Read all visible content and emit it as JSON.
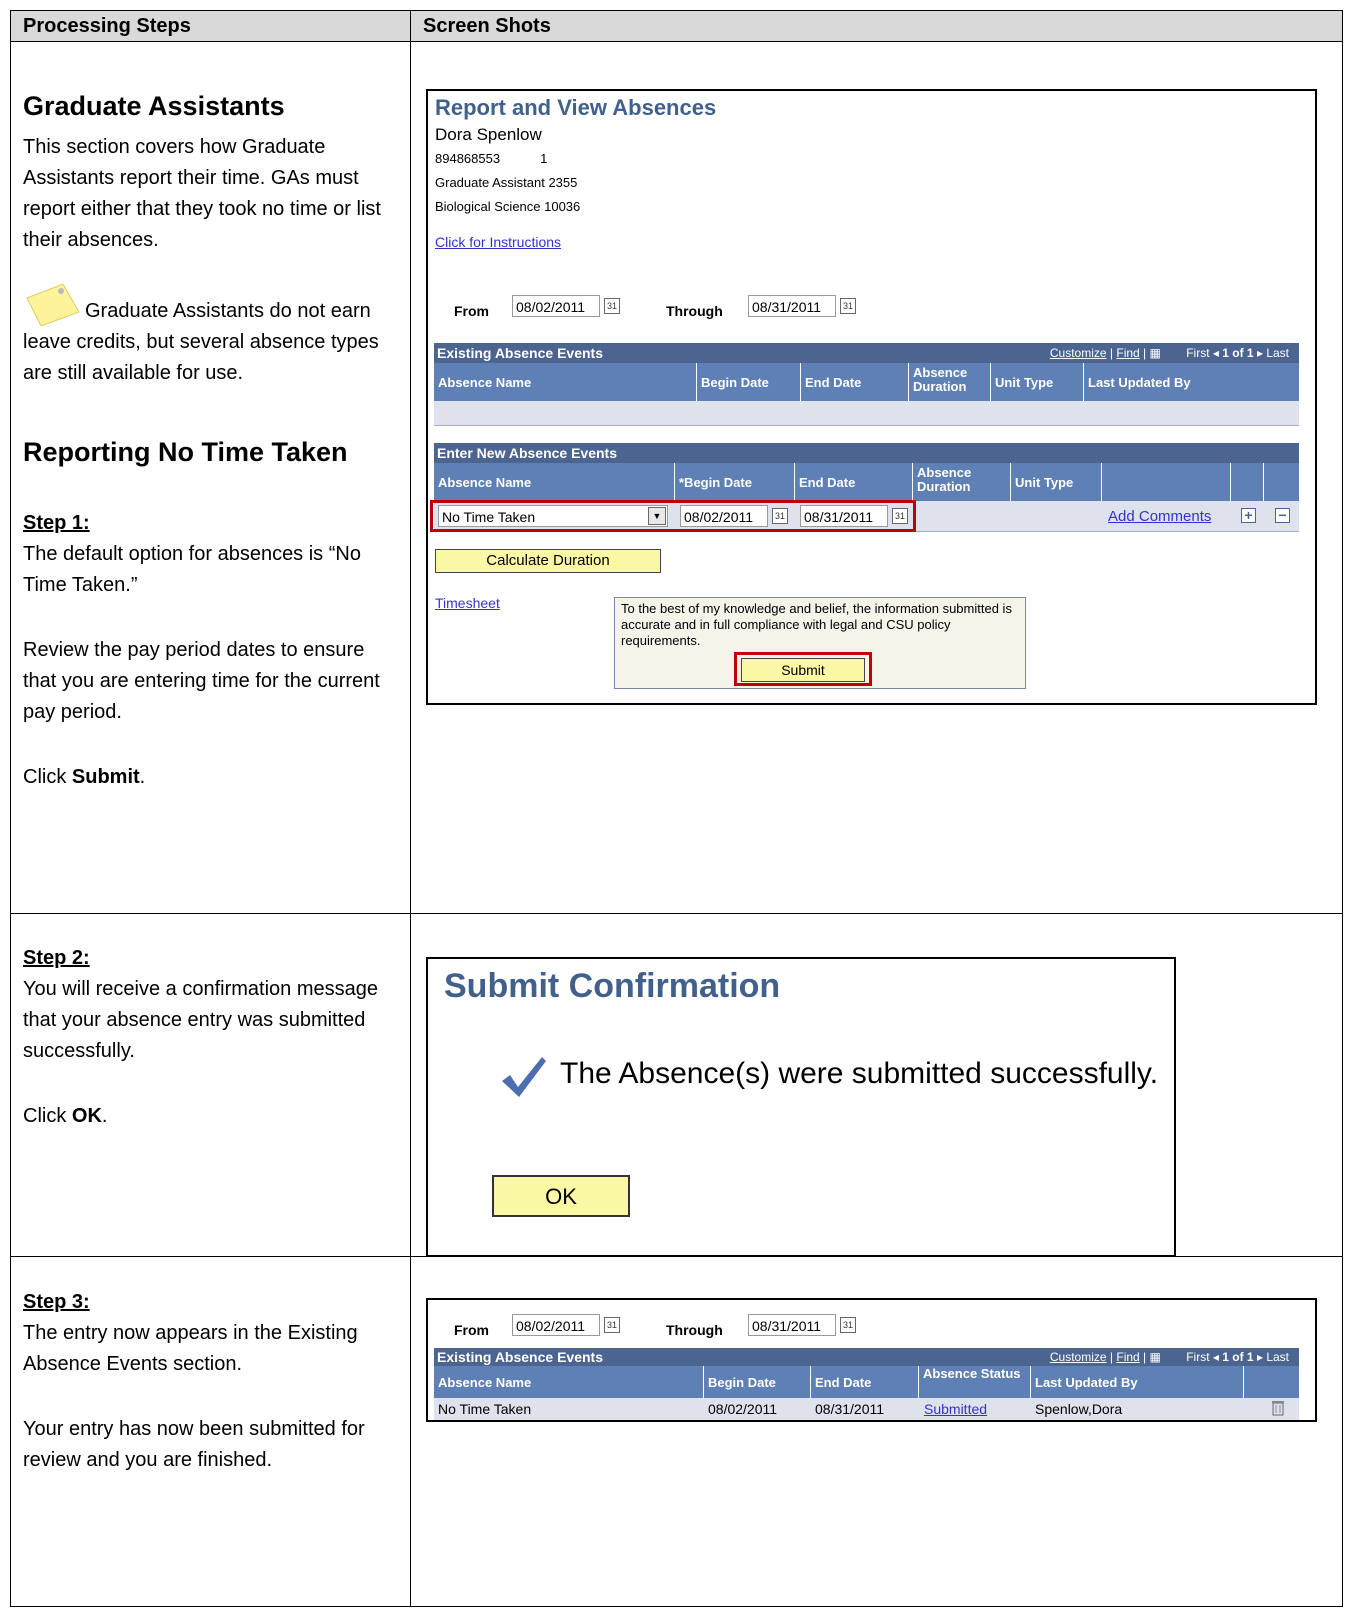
{
  "header": {
    "col1": "Processing Steps",
    "col2": "Screen Shots"
  },
  "section1": {
    "title": "Graduate Assistants",
    "intro": "This section covers how Graduate Assistants report their time. GAs must report either that they took no time or list their absences.",
    "note": "Graduate Assistants do not earn leave credits, but several absence types are still available for use.",
    "subtitle": "Reporting No Time Taken",
    "step1_label": "Step 1:",
    "step1_text": "The default option for absences is “No Time Taken.”",
    "review_text": "Review the pay period dates to ensure that you are entering time for the current pay period.",
    "click_prefix": "Click ",
    "click_bold": "Submit",
    "click_suffix": "."
  },
  "section2": {
    "step_label": "Step 2:",
    "text": "You will receive a confirmation message that your absence entry was submitted successfully.",
    "click_prefix": "Click ",
    "click_bold": "OK",
    "click_suffix": "."
  },
  "section3": {
    "step_label": "Step 3:",
    "text": "The entry now appears in the Existing Absence Events section.",
    "text2": "Your entry has now been submitted for review and you are finished."
  },
  "shot1": {
    "title": "Report and View Absences",
    "name": "Dora Spenlow",
    "emplid": "894868553",
    "record": "1",
    "job": "Graduate Assistant  2355",
    "dept": "Biological Science  10036",
    "instructions_link": "Click for Instructions",
    "from_label": "From",
    "from_value": "08/02/2011",
    "through_label": "Through",
    "through_value": "08/31/2011",
    "existing_header": "Existing Absence Events",
    "customize": "Customize",
    "find": "Find",
    "sep": "|",
    "first": "First",
    "pager": "1 of 1",
    "last": "Last",
    "existing_cols": [
      "Absence Name",
      "Begin Date",
      "End Date",
      "Absence Duration",
      "Unit Type",
      "Last Updated By"
    ],
    "new_header": "Enter New Absence Events",
    "new_cols": [
      "Absence Name",
      "*Begin Date",
      "End Date",
      "Absence Duration",
      "Unit Type"
    ],
    "select_value": "No Time Taken",
    "new_begin": "08/02/2011",
    "new_end": "08/31/2011",
    "add_comments": "Add Comments",
    "calc_button": "Calculate Duration",
    "timesheet_link": "Timesheet",
    "attest": "To the best of my knowledge and belief, the information submitted is accurate and in full compliance with legal and CSU policy requirements.",
    "submit_button": "Submit"
  },
  "shot2": {
    "title": "Submit Confirmation",
    "message": "The Absence(s) were submitted successfully.",
    "ok_button": "OK"
  },
  "shot3": {
    "from_label": "From",
    "from_value": "08/02/2011",
    "through_label": "Through",
    "through_value": "08/31/2011",
    "existing_header": "Existing Absence Events",
    "customize": "Customize",
    "find": "Find",
    "sep": "|",
    "first": "First",
    "pager": "1 of 1",
    "last": "Last",
    "cols": [
      "Absence Name",
      "Begin Date",
      "End Date",
      "Absence Status",
      "Last Updated By"
    ],
    "row": {
      "name": "No Time Taken",
      "begin": "08/02/2011",
      "end": "08/31/2011",
      "status": "Submitted",
      "updated_by": "Spenlow,Dora"
    }
  }
}
